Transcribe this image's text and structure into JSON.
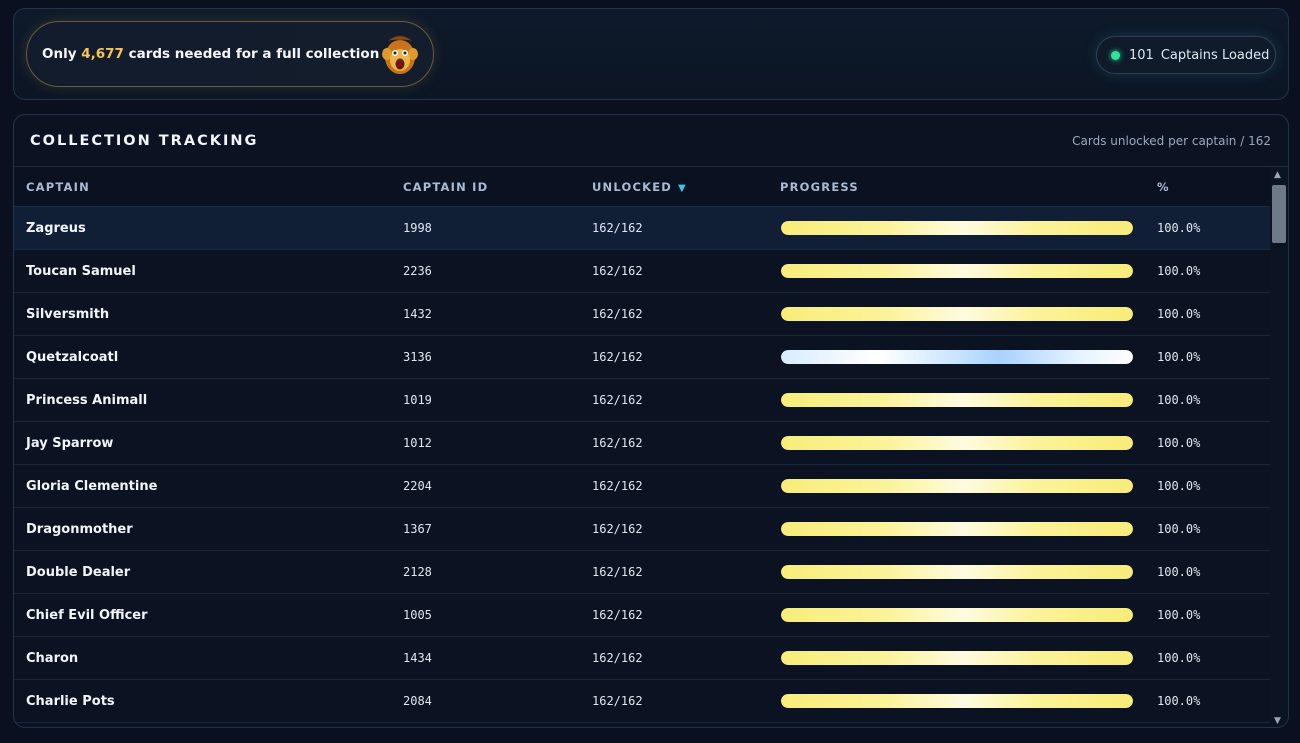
{
  "promo": {
    "prefix": "Only",
    "count": "4,677",
    "suffix": "cards needed for a full collection"
  },
  "status": {
    "count": "101",
    "label": "Captains Loaded"
  },
  "panel": {
    "title": "COLLECTION TRACKING",
    "subtitle": "Cards unlocked per captain / 162"
  },
  "table": {
    "columns": {
      "captain": "CAPTAIN",
      "captain_id": "CAPTAIN ID",
      "unlocked": "UNLOCKED",
      "progress": "PROGRESS",
      "percent": "%"
    },
    "rows": [
      {
        "name": "Zagreus",
        "id": "1998",
        "unlocked": "162/162",
        "percent": "100.0%",
        "progress": 1.0,
        "style": "gold"
      },
      {
        "name": "Toucan Samuel",
        "id": "2236",
        "unlocked": "162/162",
        "percent": "100.0%",
        "progress": 1.0,
        "style": "gold"
      },
      {
        "name": "Silversmith",
        "id": "1432",
        "unlocked": "162/162",
        "percent": "100.0%",
        "progress": 1.0,
        "style": "gold"
      },
      {
        "name": "Quetzalcoatl",
        "id": "3136",
        "unlocked": "162/162",
        "percent": "100.0%",
        "progress": 1.0,
        "style": "blue"
      },
      {
        "name": "Princess Animall",
        "id": "1019",
        "unlocked": "162/162",
        "percent": "100.0%",
        "progress": 1.0,
        "style": "gold"
      },
      {
        "name": "Jay Sparrow",
        "id": "1012",
        "unlocked": "162/162",
        "percent": "100.0%",
        "progress": 1.0,
        "style": "gold"
      },
      {
        "name": "Gloria Clementine",
        "id": "2204",
        "unlocked": "162/162",
        "percent": "100.0%",
        "progress": 1.0,
        "style": "gold"
      },
      {
        "name": "Dragonmother",
        "id": "1367",
        "unlocked": "162/162",
        "percent": "100.0%",
        "progress": 1.0,
        "style": "gold"
      },
      {
        "name": "Double Dealer",
        "id": "2128",
        "unlocked": "162/162",
        "percent": "100.0%",
        "progress": 1.0,
        "style": "gold"
      },
      {
        "name": "Chief Evil Officer",
        "id": "1005",
        "unlocked": "162/162",
        "percent": "100.0%",
        "progress": 1.0,
        "style": "gold"
      },
      {
        "name": "Charon",
        "id": "1434",
        "unlocked": "162/162",
        "percent": "100.0%",
        "progress": 1.0,
        "style": "gold"
      },
      {
        "name": "Charlie Pots",
        "id": "2084",
        "unlocked": "162/162",
        "percent": "100.0%",
        "progress": 1.0,
        "style": "gold"
      }
    ]
  },
  "icons": {
    "promo_avatar": "monkey-avatar-icon",
    "status_dot": "status-dot-icon",
    "sort": "sort-desc-icon"
  },
  "colors": {
    "accent_gold": "#f5c451",
    "status_green": "#2fe39a",
    "sort_cyan": "#3cc6e8"
  }
}
